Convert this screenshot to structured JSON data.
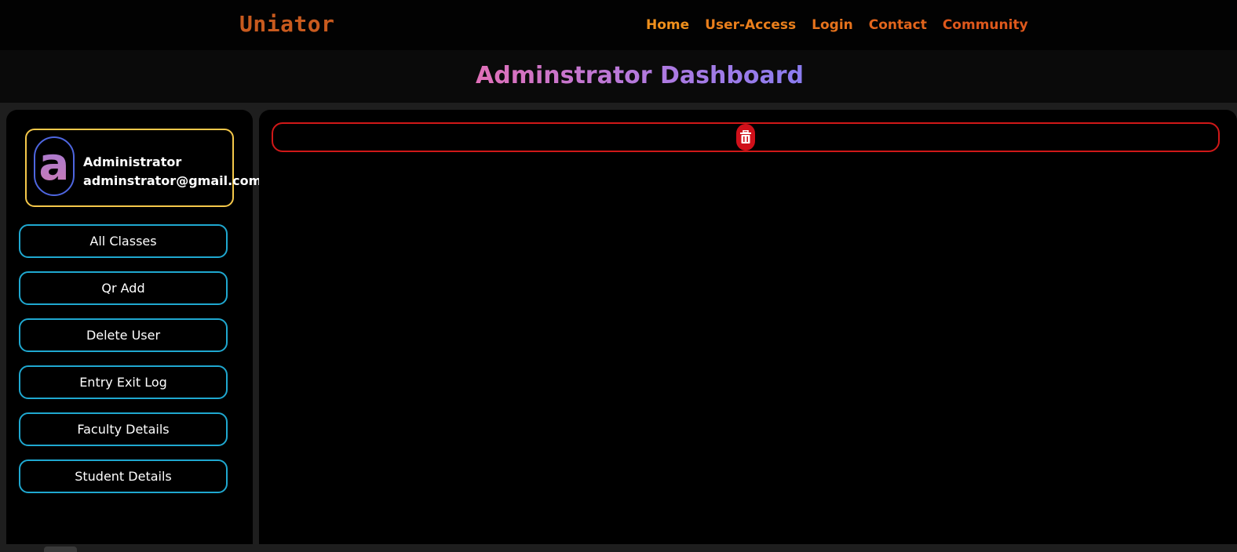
{
  "brand": {
    "name": "Uniator"
  },
  "nav": {
    "items": [
      {
        "label": "Home"
      },
      {
        "label": "User-Access"
      },
      {
        "label": "Login"
      },
      {
        "label": "Contact"
      },
      {
        "label": "Community"
      }
    ]
  },
  "header": {
    "title": "Adminstrator Dashboard"
  },
  "profile": {
    "initial": "a",
    "name": "Administrator",
    "email": "adminstrator@gmail.com"
  },
  "sidebar": {
    "buttons": [
      {
        "label": "All Classes"
      },
      {
        "label": "Qr Add"
      },
      {
        "label": "Delete User"
      },
      {
        "label": "Entry Exit Log"
      },
      {
        "label": "Faculty Details"
      },
      {
        "label": "Student Details"
      }
    ]
  },
  "main": {
    "delete_icon": "trash-icon"
  },
  "colors": {
    "brand": "#c85a1e",
    "nav": "#e8741c",
    "title_gradient_start": "#e070b8",
    "title_gradient_end": "#8a7cf0",
    "profile_border": "#f5c84a",
    "avatar_border": "#4e66e0",
    "button_border": "#1fa8d0",
    "delete_border": "#d01818"
  }
}
